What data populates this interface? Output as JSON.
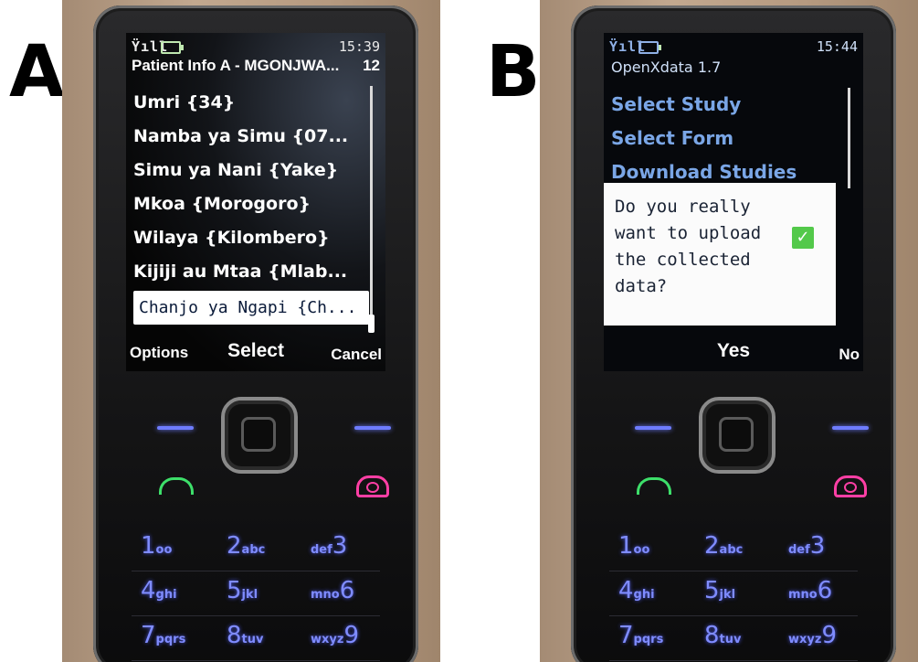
{
  "panels": [
    {
      "label": "A",
      "status": {
        "signal": "Ÿıll",
        "time": "15:39"
      },
      "title": "Patient Info A - MGONJWA...",
      "count": "12",
      "items": [
        "Umri {34}",
        "Namba ya Simu {07...",
        "Simu ya Nani {Yake}",
        "Mkoa {Morogoro}",
        "Wilaya {Kilombero}",
        "Kijiji au Mtaa {Mlab...",
        "Chanjo ya Ngapi {Ch..."
      ],
      "softkeys": {
        "left": "Options",
        "middle": "Select",
        "right": "Cancel"
      }
    },
    {
      "label": "B",
      "status": {
        "signal": "Ÿıll",
        "time": "15:44"
      },
      "app_title": "OpenXdata 1.7",
      "menu": [
        "Select Study",
        "Select Form",
        "Download Studies"
      ],
      "dialog": {
        "message": "Do you really want to upload the collected data?",
        "check": "✓"
      },
      "softkeys": {
        "middle": "Yes",
        "right": "No"
      }
    }
  ],
  "keypad": [
    [
      {
        "d": "1",
        "l": "oo"
      },
      {
        "d": "2",
        "l": "abc"
      },
      {
        "d": "3",
        "l": "def"
      }
    ],
    [
      {
        "d": "4",
        "l": "ghi"
      },
      {
        "d": "5",
        "l": "jkl"
      },
      {
        "d": "6",
        "l": "mno"
      }
    ],
    [
      {
        "d": "7",
        "l": "pqrs"
      },
      {
        "d": "8",
        "l": "tuv"
      },
      {
        "d": "9",
        "l": "wxyz"
      }
    ]
  ]
}
